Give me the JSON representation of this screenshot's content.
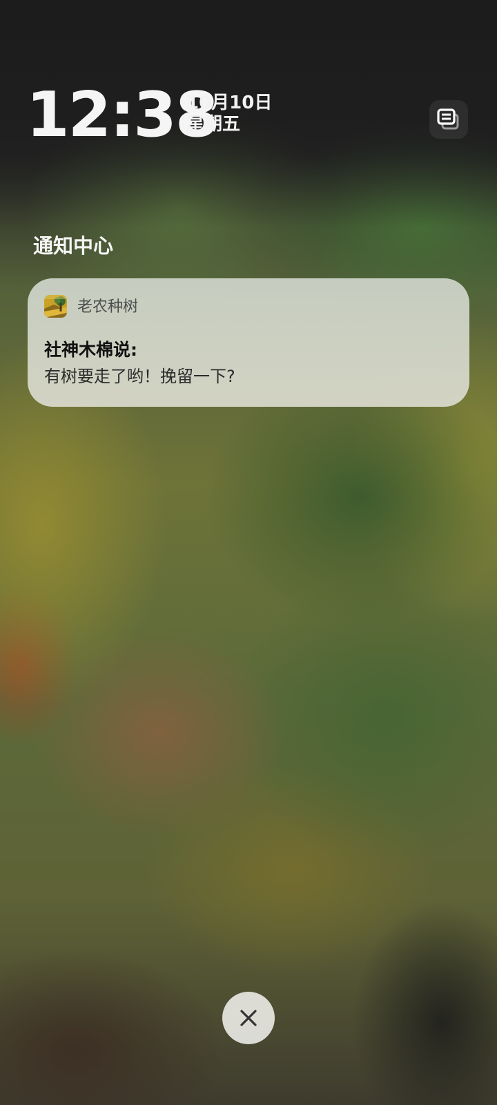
{
  "lock_screen": {
    "time": "12:38",
    "date": "10月10日",
    "weekday": "星期五"
  },
  "toolbar": {
    "multi_window_icon": "stacked-windows-icon"
  },
  "notification_center": {
    "title": "通知中心"
  },
  "notifications": [
    {
      "app_icon": "tree-app-icon",
      "app_name": "老农种树",
      "title": "社神木棉说:",
      "body": "有树要走了哟！挽留一下?"
    }
  ],
  "footer": {
    "close_icon": "close-icon"
  }
}
